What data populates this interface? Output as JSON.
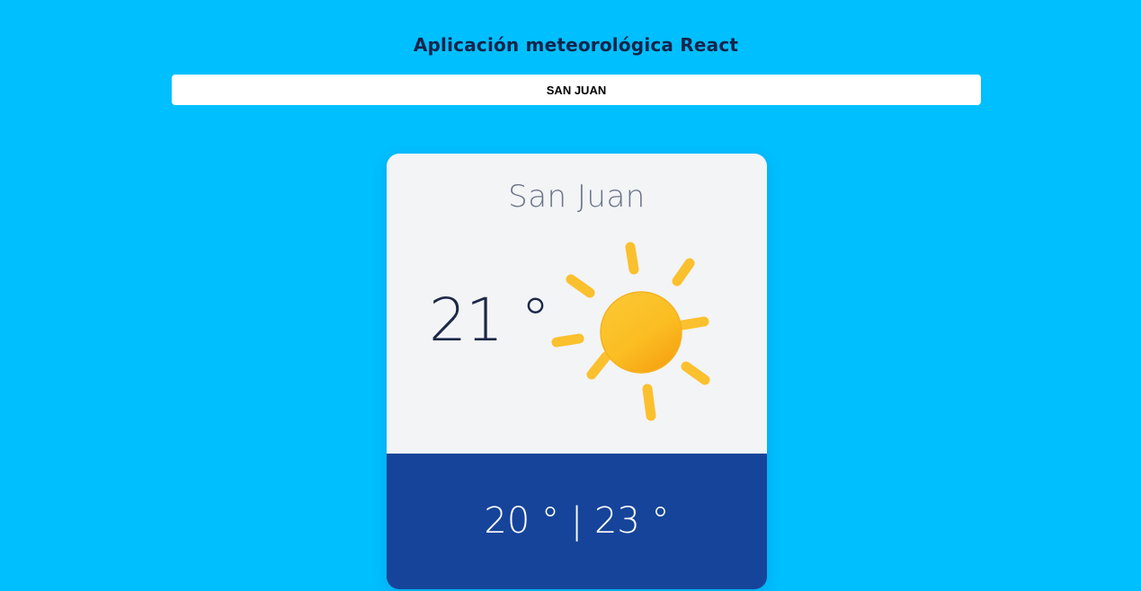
{
  "header": {
    "title": "Aplicación meteorológica React"
  },
  "search": {
    "value": "SAN JUAN"
  },
  "weather_card": {
    "city": "San Juan",
    "temperature": "21 °",
    "condition_icon": "sun-icon",
    "min_max": "20 ° | 23 °"
  },
  "colors": {
    "background": "#00BFFF",
    "card_top": "#f2f4f6",
    "card_bottom": "#16449a",
    "sun": "#fbbf24"
  }
}
